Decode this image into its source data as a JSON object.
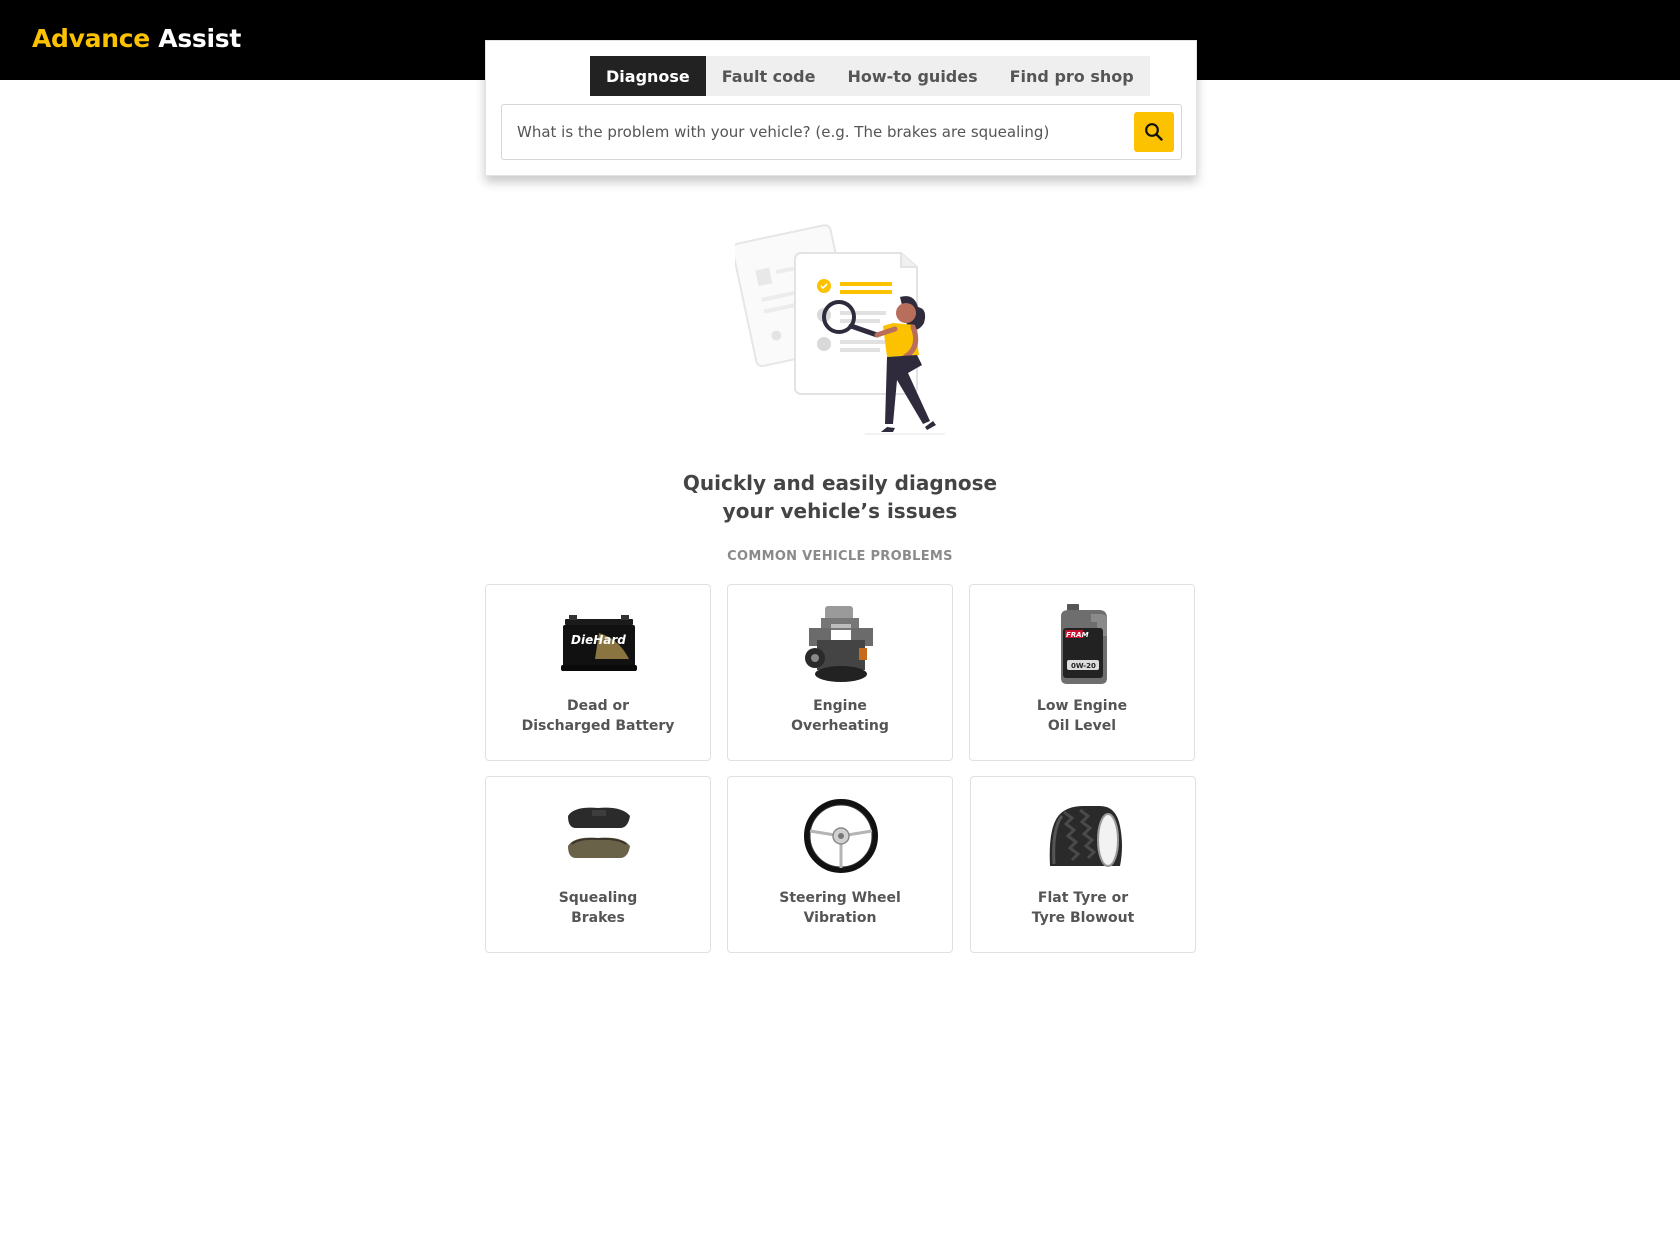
{
  "brand": {
    "part1": "Advance",
    "part2": "Assist"
  },
  "tabs": [
    {
      "label": "Diagnose",
      "active": true
    },
    {
      "label": "Fault code",
      "active": false
    },
    {
      "label": "How-to guides",
      "active": false
    },
    {
      "label": "Find pro shop",
      "active": false
    }
  ],
  "search": {
    "placeholder": "What is the problem with your vehicle? (e.g. The brakes are squealing)",
    "icon": "search-icon"
  },
  "headline": {
    "line1": "Quickly and easily diagnose",
    "line2": "your vehicle’s issues"
  },
  "section_label": "COMMON VEHICLE PROBLEMS",
  "problems": [
    {
      "line1": "Dead or",
      "line2": "Discharged Battery",
      "icon": "battery-image"
    },
    {
      "line1": "Engine",
      "line2": "Overheating",
      "icon": "engine-image"
    },
    {
      "line1": "Low Engine",
      "line2": "Oil Level",
      "icon": "oil-bottle-image"
    },
    {
      "line1": "Squealing",
      "line2": "Brakes",
      "icon": "brake-pads-image"
    },
    {
      "line1": "Steering Wheel",
      "line2": "Vibration",
      "icon": "steering-wheel-image"
    },
    {
      "line1": "Flat Tyre or",
      "line2": "Tyre Blowout",
      "icon": "tyre-image"
    }
  ],
  "images": {
    "battery_brand": "DieHard",
    "oil_brand": "FRAM",
    "oil_grade": "0W-20"
  },
  "colors": {
    "accent": "#fcc200",
    "topbar": "#000000",
    "active_tab": "#222222"
  }
}
